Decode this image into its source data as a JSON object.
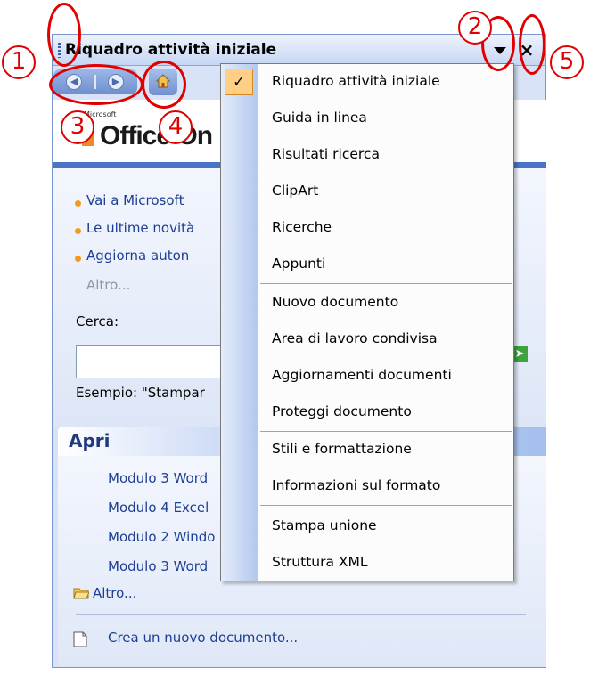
{
  "task_pane": {
    "title": "Riquadro attività iniziale",
    "close_glyph": "×",
    "logo": {
      "microsoft": "Microsoft",
      "office_online": "Office On"
    },
    "links": [
      "Vai a Microsoft",
      "Le ultime novità",
      "Aggiorna auton"
    ],
    "more_link": "Altro...",
    "search_label": "Cerca:",
    "search_value": "",
    "example_text": "Esempio: \"Stampar",
    "open_section": {
      "title": "Apri",
      "files": [
        "Modulo 3 Word",
        "Modulo 4 Excel",
        "Modulo 2 Windo",
        "Modulo 3 Word"
      ],
      "more": "Altro...",
      "new_document": "Crea un nuovo documento..."
    }
  },
  "menu": {
    "items": [
      {
        "label": "Riquadro attività iniziale",
        "checked": true
      },
      {
        "label": "Guida in linea"
      },
      {
        "label": "Risultati ricerca"
      },
      {
        "label": "ClipArt"
      },
      {
        "label": "Ricerche"
      },
      {
        "label": "Appunti"
      },
      {
        "label": "Nuovo documento"
      },
      {
        "label": "Area di lavoro condivisa"
      },
      {
        "label": "Aggiornamenti documenti"
      },
      {
        "label": "Proteggi documento"
      },
      {
        "label": "Stili e formattazione"
      },
      {
        "label": "Informazioni sul formato"
      },
      {
        "label": "Stampa unione"
      },
      {
        "label": "Struttura XML"
      }
    ],
    "check_glyph": "✓"
  },
  "callouts": [
    "1",
    "2",
    "3",
    "4",
    "5"
  ],
  "colors": {
    "callout": "#e00000",
    "title_bar": "#c6d6f3",
    "link": "#1d3f93",
    "menu_highlight": "#ffcf85",
    "bullet": "#f39a1c"
  }
}
